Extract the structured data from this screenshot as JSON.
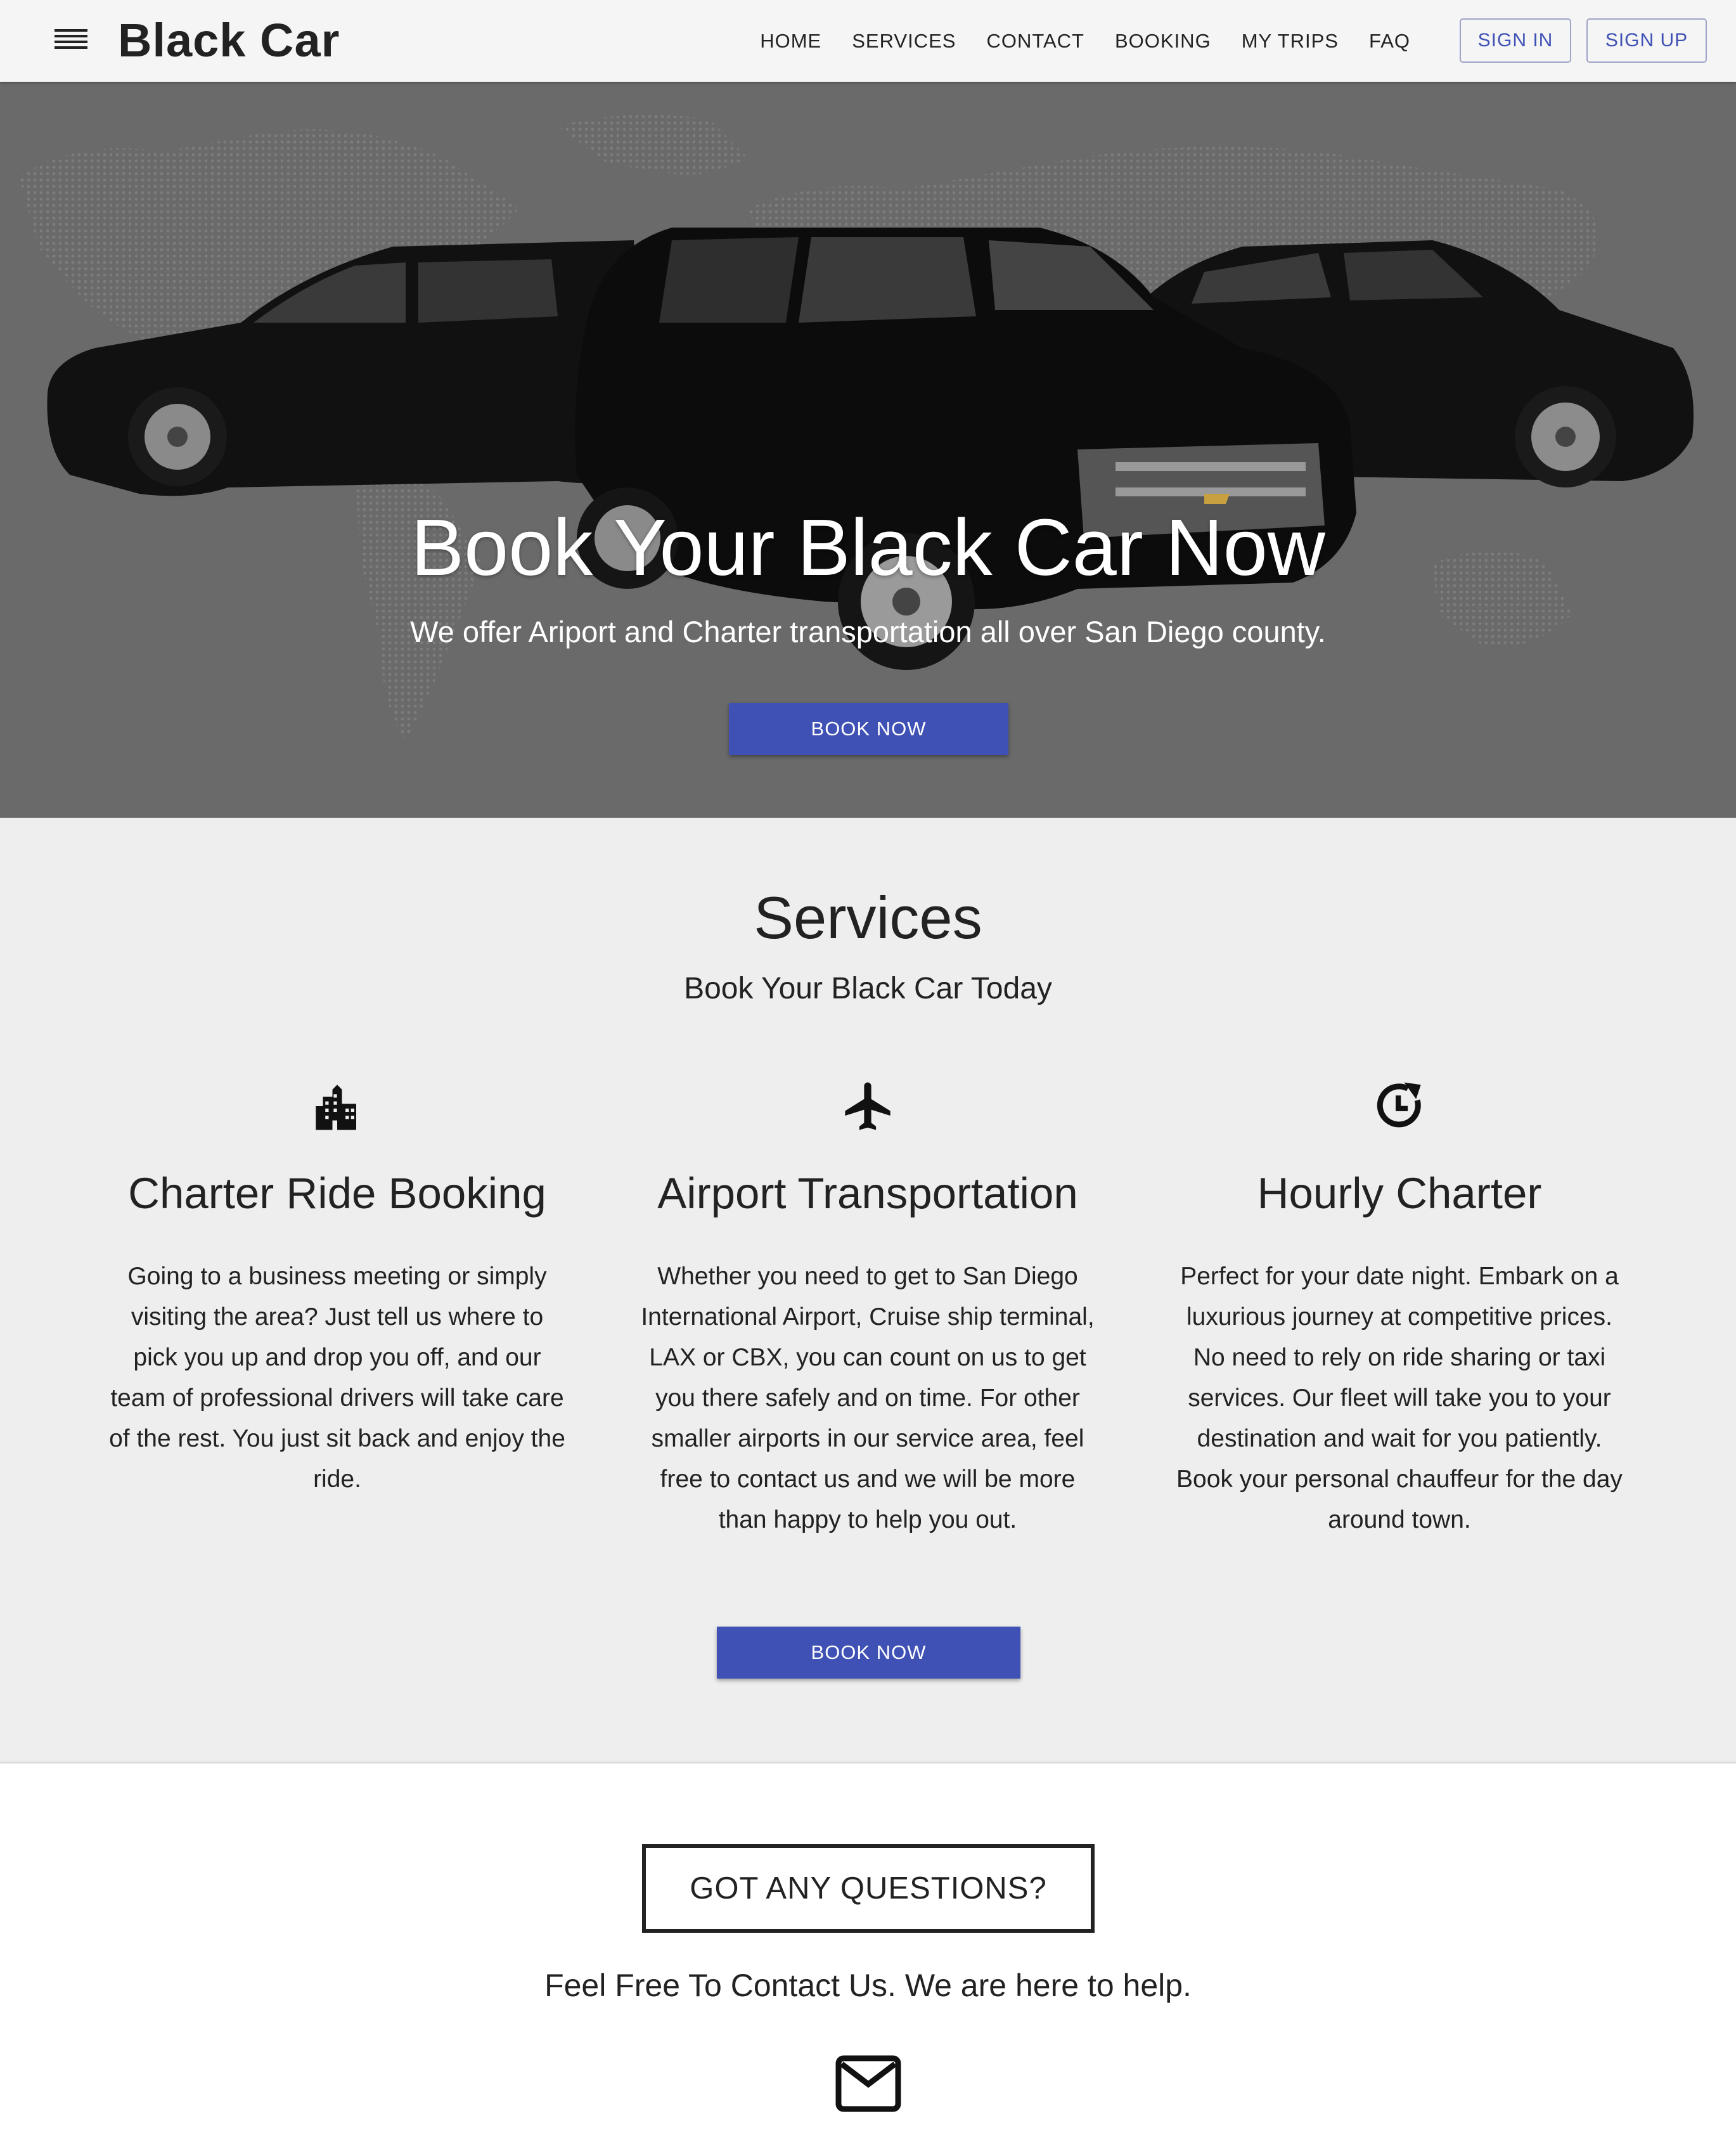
{
  "navbar": {
    "brand": "Black Car",
    "links": [
      "HOME",
      "SERVICES",
      "CONTACT",
      "BOOKING",
      "MY TRIPS",
      "FAQ"
    ],
    "sign_in": "SIGN IN",
    "sign_up": "SIGN UP",
    "menu_icon": "hamburger-menu-icon",
    "accent_color": "#3f51b5"
  },
  "hero": {
    "title": "Book Your Black Car Now",
    "subtitle": "We offer Ariport and Charter transportation all over San Diego county.",
    "button": "BOOK NOW"
  },
  "services": {
    "title": "Services",
    "subtitle": "Book Your Black Car Today",
    "items": [
      {
        "icon": "building-icon",
        "title": "Charter Ride Booking",
        "text": "Going to a business meeting or simply visiting the area? Just tell us where to pick you up and drop you off, and our team of professional drivers will take care of the rest. You just sit back and enjoy the ride."
      },
      {
        "icon": "airplane-icon",
        "title": "Airport Transportation",
        "text": "Whether you need to get to San Diego International Airport, Cruise ship terminal, LAX or CBX, you can count on us to get you there safely and on time. For other smaller airports in our service area, feel free to contact us and we will be more than happy to help you out."
      },
      {
        "icon": "clock-refresh-icon",
        "title": "Hourly Charter",
        "text": "Perfect for your date night. Embark on a luxurious journey at competitive prices. No need to rely on ride sharing or taxi services. Our fleet will take you to your destination and wait for you patiently. Book your personal chauffeur for the day around town."
      }
    ],
    "button": "BOOK NOW"
  },
  "contact": {
    "heading": "GOT ANY QUESTIONS?",
    "subtitle": "Feel Free To Contact Us. We are here to help.",
    "mail_icon": "mail-icon"
  }
}
